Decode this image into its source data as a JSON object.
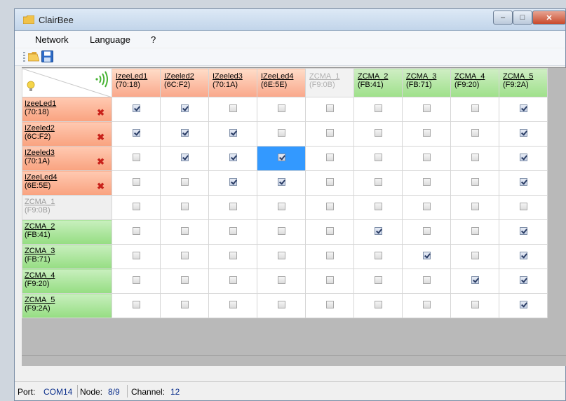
{
  "window": {
    "title": "ClairBee"
  },
  "menu": {
    "items": [
      "Network",
      "Language",
      "?"
    ]
  },
  "grid": {
    "columns": [
      {
        "name": "IzeeLed1",
        "addr": "(70:18)",
        "state": "red"
      },
      {
        "name": "IZeeled2",
        "addr": "(6C:F2)",
        "state": "red"
      },
      {
        "name": "IZeeled3",
        "addr": "(70:1A)",
        "state": "red"
      },
      {
        "name": "IZeeLed4",
        "addr": "(6E:5E)",
        "state": "red"
      },
      {
        "name": "ZCMA_1",
        "addr": "(F9:0B)",
        "state": "grey"
      },
      {
        "name": "ZCMA_2",
        "addr": "(FB:41)",
        "state": "green"
      },
      {
        "name": "ZCMA_3",
        "addr": "(FB:71)",
        "state": "green"
      },
      {
        "name": "ZCMA_4",
        "addr": "(F9:20)",
        "state": "green"
      },
      {
        "name": "ZCMA_5",
        "addr": "(F9:2A)",
        "state": "green"
      }
    ],
    "rows": [
      {
        "name": "IzeeLed1",
        "addr": "(70:18)",
        "state": "red",
        "remove": true,
        "checks": [
          1,
          1,
          0,
          0,
          0,
          0,
          0,
          0,
          1
        ]
      },
      {
        "name": "IZeeled2",
        "addr": "(6C:F2)",
        "state": "red",
        "remove": true,
        "checks": [
          1,
          1,
          1,
          0,
          0,
          0,
          0,
          0,
          1
        ]
      },
      {
        "name": "IZeeled3",
        "addr": "(70:1A)",
        "state": "red",
        "remove": true,
        "checks": [
          0,
          1,
          1,
          1,
          0,
          0,
          0,
          0,
          1
        ]
      },
      {
        "name": "IZeeLed4",
        "addr": "(6E:5E)",
        "state": "red",
        "remove": true,
        "checks": [
          0,
          0,
          1,
          1,
          0,
          0,
          0,
          0,
          1
        ]
      },
      {
        "name": "ZCMA_1",
        "addr": "(F9:0B)",
        "state": "grey",
        "remove": false,
        "checks": [
          0,
          0,
          0,
          0,
          0,
          0,
          0,
          0,
          0
        ]
      },
      {
        "name": "ZCMA_2",
        "addr": "(FB:41)",
        "state": "green",
        "remove": false,
        "checks": [
          0,
          0,
          0,
          0,
          0,
          1,
          0,
          0,
          1
        ]
      },
      {
        "name": "ZCMA_3",
        "addr": "(FB:71)",
        "state": "green",
        "remove": false,
        "checks": [
          0,
          0,
          0,
          0,
          0,
          0,
          1,
          0,
          1
        ]
      },
      {
        "name": "ZCMA_4",
        "addr": "(F9:20)",
        "state": "green",
        "remove": false,
        "checks": [
          0,
          0,
          0,
          0,
          0,
          0,
          0,
          1,
          1
        ]
      },
      {
        "name": "ZCMA_5",
        "addr": "(F9:2A)",
        "state": "green",
        "remove": false,
        "checks": [
          0,
          0,
          0,
          0,
          0,
          0,
          0,
          0,
          1
        ]
      }
    ],
    "selected_cell": {
      "row": 2,
      "col": 3
    }
  },
  "status": {
    "port_label": "Port:",
    "port_value": "COM14",
    "node_label": "Node:",
    "node_value": "8/9",
    "channel_label": "Channel:",
    "channel_value": "12"
  }
}
